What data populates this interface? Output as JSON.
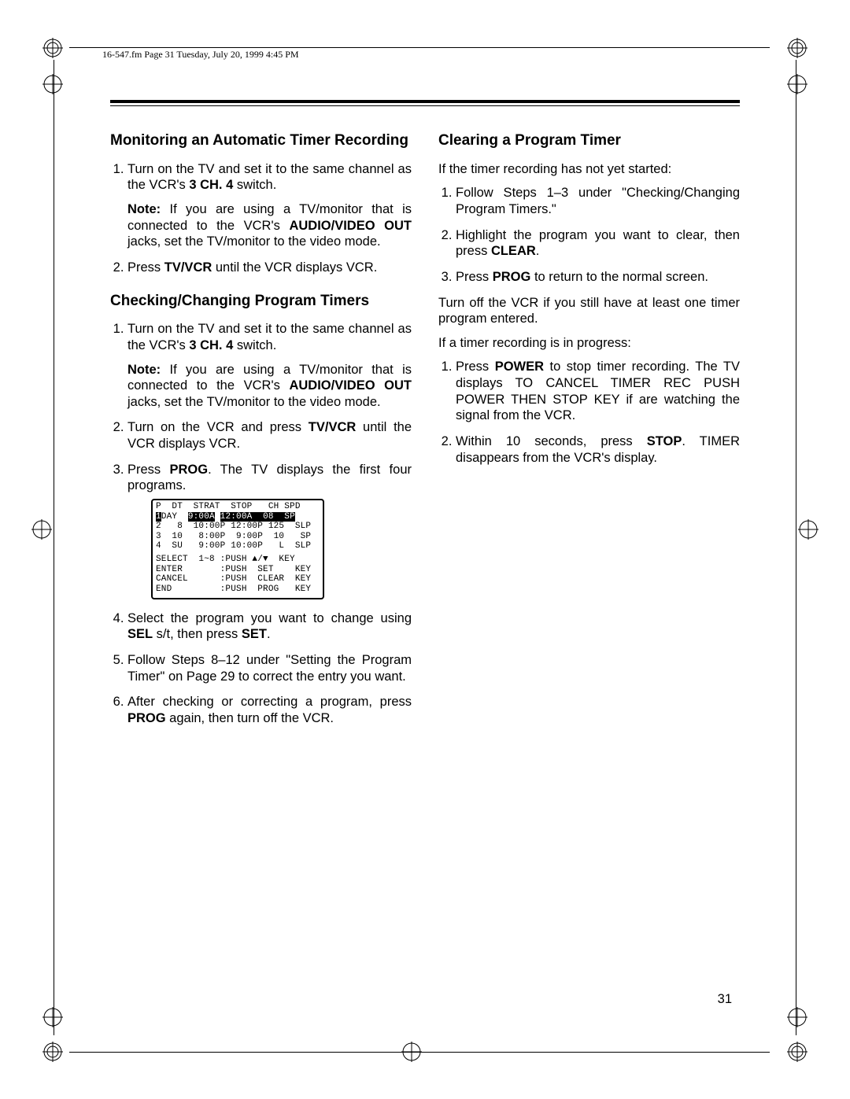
{
  "header": {
    "running_head": "16-547.fm  Page 31  Tuesday, July 20, 1999  4:45 PM"
  },
  "page_number": "31",
  "left": {
    "h_monitor": "Monitoring an Automatic Timer Recording",
    "mon_1a": "Turn on the TV and set it to the same channel as the VCR's ",
    "mon_1b": "3 CH. 4",
    "mon_1c": " switch.",
    "mon_note_label": "Note:",
    "mon_note_a": " If you are using a TV/monitor that is connected to the VCR's ",
    "mon_note_b": "AUDIO/VIDEO OUT",
    "mon_note_c": " jacks, set the TV/monitor to the video mode.",
    "mon_2a": "Press ",
    "mon_2b": "TV/VCR",
    "mon_2c": " until the VCR displays VCR.",
    "h_check": "Checking/Changing Program Timers",
    "chk_1a": "Turn on the TV and set it to the same channel as the VCR's ",
    "chk_1b": "3 CH. 4",
    "chk_1c": " switch.",
    "chk_note_label": "Note:",
    "chk_note_a": " If you are using a TV/monitor that is connected to the VCR's ",
    "chk_note_b": "AUDIO/VIDEO OUT",
    "chk_note_c": " jacks, set the TV/monitor to the video mode.",
    "chk_2a": "Turn on the VCR and press ",
    "chk_2b": "TV/VCR",
    "chk_2c": " until the VCR displays VCR.",
    "chk_3a": "Press ",
    "chk_3b": "PROG",
    "chk_3c": ". The TV displays the first four programs.",
    "chk_4a": "Select the program you want to change using ",
    "chk_4b": "SEL",
    "chk_4c": " s/t, then press ",
    "chk_4d": "SET",
    "chk_4e": ".",
    "chk_5": "Follow Steps 8–12 under \"Setting the Program Timer\" on Page 29 to correct the entry you want.",
    "chk_6a": "After checking or correcting a program, press ",
    "chk_6b": "PROG",
    "chk_6c": " again, then turn off the VCR."
  },
  "osd": {
    "head": "P  DT  STRAT  STOP   CH SPD",
    "r1_inv1": "1",
    "r1_a": "DAY  ",
    "r1_inv2": "9:00A",
    "r1_mid": " ",
    "r1_inv3": "12:00A  08  SP",
    "r2": "2   8  10:00P 12:00P 125  SLP",
    "r3": "3  10   8:00P  9:00P  10   SP",
    "r4": "4  SU   9:00P 10:00P   L  SLP",
    "f1": "SELECT  1~8 :PUSH ▲/▼  KEY",
    "f2": "ENTER       :PUSH  SET    KEY",
    "f3": "CANCEL      :PUSH  CLEAR  KEY",
    "f4": "END         :PUSH  PROG   KEY"
  },
  "right": {
    "h_clear": "Clearing a Program Timer",
    "intro1": "If the timer recording has not yet started:",
    "c1": "Follow Steps 1–3 under \"Checking/Changing Program Timers.\"",
    "c2a": "Highlight the program you want to clear, then press ",
    "c2b": "CLEAR",
    "c2c": ".",
    "c3a": "Press ",
    "c3b": "PROG",
    "c3c": " to return to the normal screen.",
    "after": "Turn off the VCR if you still have at least one timer program entered.",
    "intro2": "If a timer recording is in progress:",
    "p1a": "Press ",
    "p1b": "POWER",
    "p1c": " to stop timer recording. The TV displays TO CANCEL TIMER REC PUSH POWER THEN STOP KEY if  are watching the signal from the VCR.",
    "p2a": "Within 10 seconds, press ",
    "p2b": "STOP",
    "p2c": ". TIMER disappears from the VCR's display."
  }
}
